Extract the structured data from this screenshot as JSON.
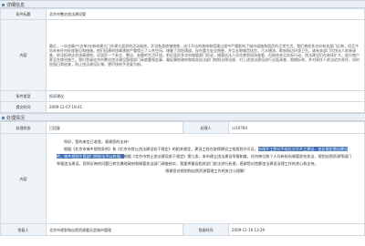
{
  "section1": {
    "title": "详细信息",
    "rows": {
      "title_label": "条件标题",
      "title_value": "北京市整治违法建设管",
      "content_label": "内容",
      "content_text": "最近，一伙违章户(名单)在新修建大门外建大面积的活动板房，开设各类商铺销售，由于开店的装修和搭建过程中严重影响了城市道路和居民的正常生活。我们曾经多次向有关部门反映，但至今尚未有任何处理意见和措施。他们搭建的违章建筑严重侵占了公共空间，堵塞了消防通道，存在重大安全隐患，并且长期噪音扰民，污水横流，影响周边环境卫生。请有关部门尽快派人前来调查，依法拆除这些违章建筑，还居民一个安全、整洁、安静的生活环境。附近居民多次向城管部门投诉，城管执法人员也曾到现场查看，但始终未见实际行动，违法建设仍在继续扩大，部分商户甚至在夜间施工。我们恳请北京市整治违法建设管理部门高度重视此事，督促属地政府和相关执法部门按照法律法规，对上述违法建设进行全面清查，限期拆除，并对责任人依法追究责任，同时加强日常巡查，防止违法建设反弹。望尽快给予答复为盼。",
      "type_label": "条件类型",
      "type_value": "投诉建议",
      "time_label": "提交时间",
      "time_value": "2009-11-07 19:41"
    }
  },
  "section2": {
    "title": "处理情况",
    "rows": {
      "status_label": "处理状态",
      "status_value": "已回复",
      "handler_label": "处理人",
      "handler_value": "cs10784",
      "content_label": "内容",
      "dept_label": "答复人",
      "dept_value": "北京市规划和自然资源委员会城市管理",
      "reply_time_label": "答复时间",
      "reply_time_value": "2009-11-10 13:29"
    },
    "reply": {
      "greeting": "你好，您的来信已收悉，感谢您的支持！",
      "para_before": "根据《北京市城乡规划条例》和《北京市禁止违法建设若干规定》的相关规定，建设工程在取得建设工程规划许可证，",
      "para_highlight": "办理开工登记手续后方可开工建设，违反规定擅自建设的，城乡规划主管部门将依法予以处理。",
      "para_after": "根据《北京市禁止违法建设若干规定》第九条，本市建立违法建设举报制度，任何单位和个人均有权向城管综合执法、规划自然资源等部门举报违法建设。您所反映的问题已转交属地政府和城管执法部门调查核实，我委将督促相关部门依法进行处理，感谢您对首都违法建设治理工作的关心和支持。",
      "thanks": "感谢您对规划和自然资源管理工作的关注与理解!"
    }
  }
}
